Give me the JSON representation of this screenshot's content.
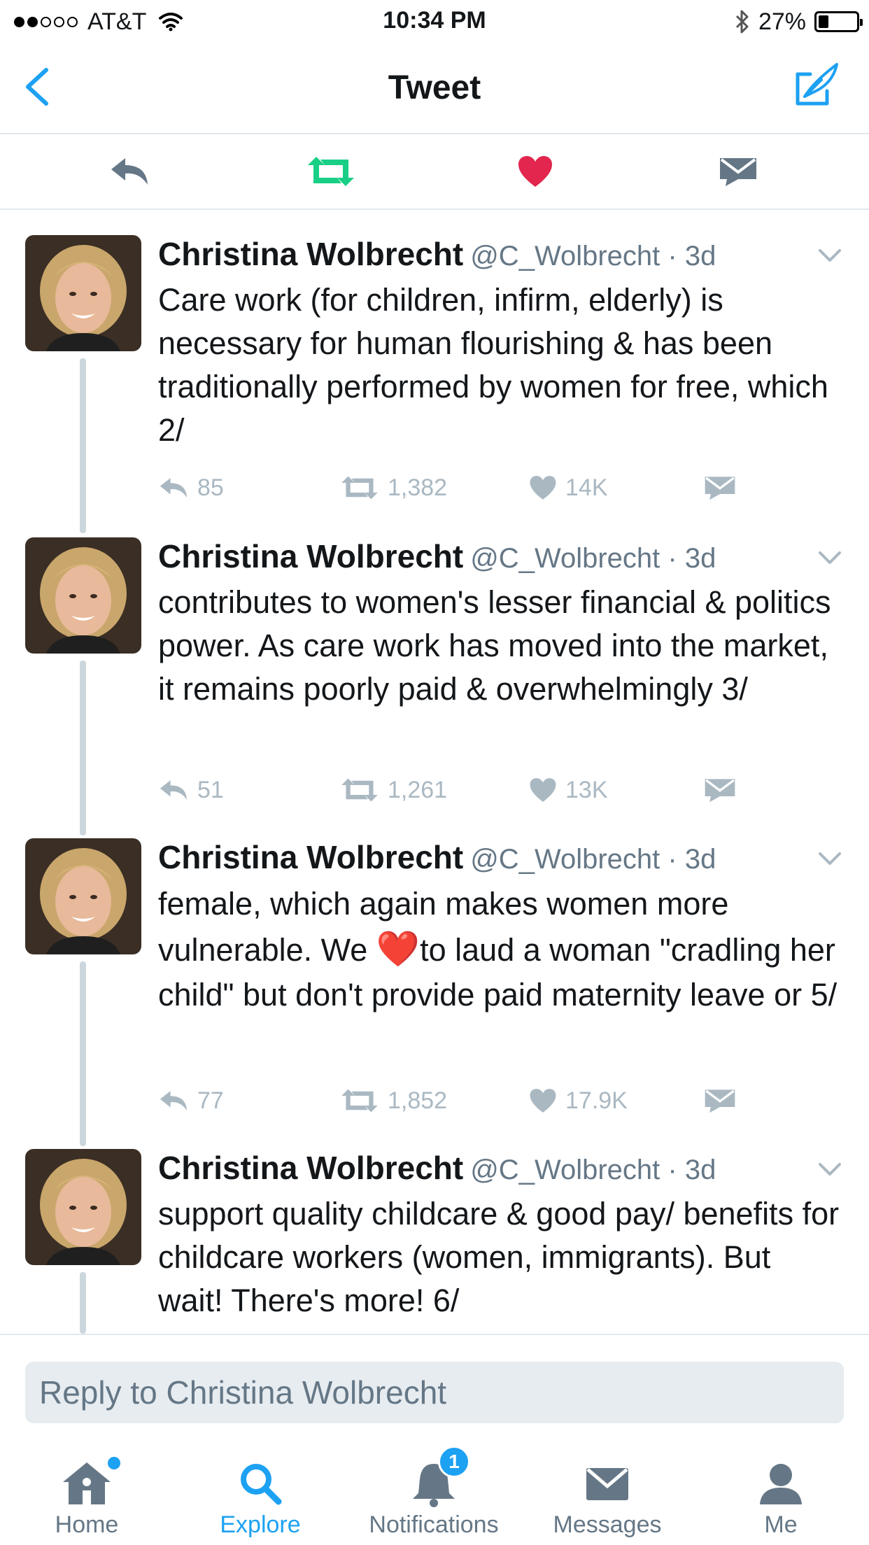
{
  "status_bar": {
    "carrier": "AT&T",
    "time": "10:34 PM",
    "battery_percent": "27%",
    "battery_level": 0.27,
    "signal_bars_filled": 2,
    "signal_bars_total": 5
  },
  "nav": {
    "title": "Tweet",
    "back_icon": "chevron-left-icon",
    "compose_icon": "compose-icon"
  },
  "actions": [
    {
      "icon": "reply-icon",
      "color": "#657786"
    },
    {
      "icon": "retweet-icon",
      "color": "#19cf86"
    },
    {
      "icon": "like-icon",
      "color": "#e2264d"
    },
    {
      "icon": "dm-icon",
      "color": "#657786"
    }
  ],
  "tweets": [
    {
      "name": "Christina Wolbrecht",
      "handle": "@C_Wolbrecht · 3d",
      "text": "Care work (for children, infirm, elderly) is necessary for human flourishing & has been traditionally performed by women for free, which 2/",
      "replies": "85",
      "retweets": "1,382",
      "likes": "14K"
    },
    {
      "name": "Christina Wolbrecht",
      "handle": "@C_Wolbrecht · 3d",
      "text": "contributes to women's lesser financial & politics power. As care work has moved into the market, it remains poorly paid & overwhelmingly 3/",
      "replies": "51",
      "retweets": "1,261",
      "likes": "13K"
    },
    {
      "name": "Christina Wolbrecht",
      "handle": "@C_Wolbrecht · 3d",
      "text_before": "female, which again makes women more vulnerable. We ",
      "emoji": "❤️",
      "text_after": "to laud a woman \"cradling her child\" but don't provide paid maternity leave or 5/",
      "replies": "77",
      "retweets": "1,852",
      "likes": "17.9K"
    },
    {
      "name": "Christina Wolbrecht",
      "handle": "@C_Wolbrecht · 3d",
      "text": "support quality childcare & good pay/ benefits for childcare workers (women, immigrants). But wait! There's more! 6/"
    }
  ],
  "reply_box": {
    "placeholder": "Reply to Christina Wolbrecht"
  },
  "tabs": [
    {
      "label": "Home",
      "icon": "home-icon",
      "active": false
    },
    {
      "label": "Explore",
      "icon": "search-icon",
      "active": true
    },
    {
      "label": "Notifications",
      "icon": "bell-icon",
      "active": false,
      "badge": "1"
    },
    {
      "label": "Messages",
      "icon": "envelope-icon",
      "active": false
    },
    {
      "label": "Me",
      "icon": "person-icon",
      "active": false
    }
  ],
  "colors": {
    "accent": "#1da1f2",
    "retweet": "#19cf86",
    "like": "#e2264d",
    "muted": "#aab8c2"
  }
}
